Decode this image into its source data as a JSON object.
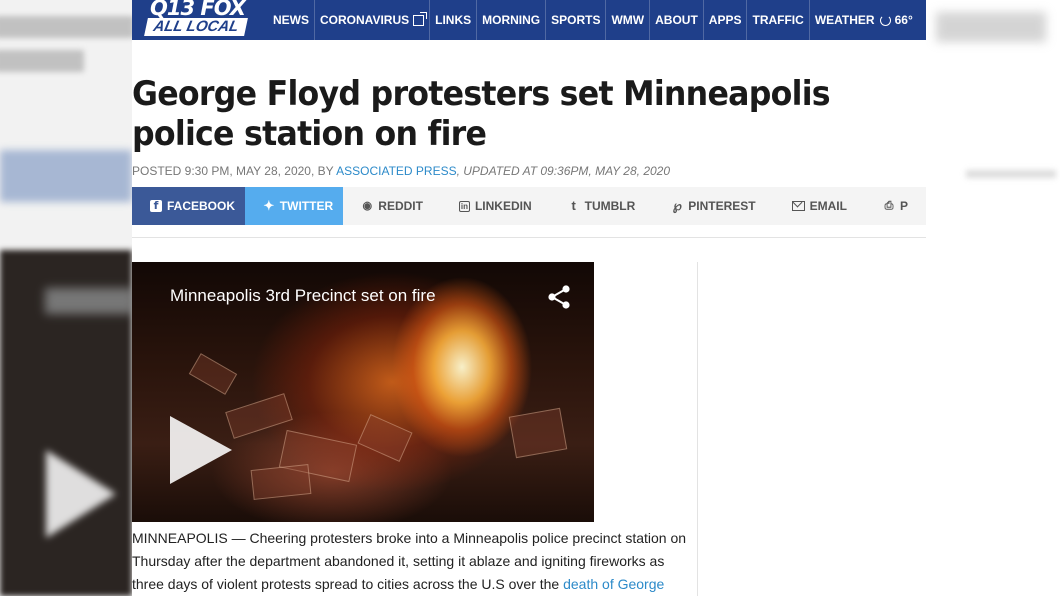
{
  "site": {
    "logo_top": "Q13 FOX",
    "logo_bottom": "ALL LOCAL"
  },
  "nav": {
    "items": [
      "NEWS",
      "CORONAVIRUS",
      "LINKS",
      "MORNING",
      "SPORTS",
      "WMW",
      "ABOUT",
      "APPS",
      "TRAFFIC",
      "WEATHER"
    ],
    "weather_temp": "66°"
  },
  "article": {
    "headline": "George Floyd protesters set Minneapolis police station on fire",
    "byline_prefix": "POSTED 9:30 PM, MAY 28, 2020, BY ",
    "author": "ASSOCIATED PRESS",
    "updated": ", UPDATED AT 09:36PM, MAY 28, 2020",
    "body_text": "MINNEAPOLIS — Cheering protesters broke into a Minneapolis police precinct station on Thursday after the department abandoned it, setting it ablaze and igniting fireworks as three days of violent protests spread to cities across the U.S over the ",
    "body_link": "death of George"
  },
  "share": {
    "buttons": [
      "FACEBOOK",
      "TWITTER",
      "REDDIT",
      "LINKEDIN",
      "TUMBLR",
      "PINTEREST",
      "EMAIL",
      "P"
    ]
  },
  "video": {
    "title": "Minneapolis 3rd Precinct set on fire"
  },
  "colors": {
    "header_bg": "#1f3f8a",
    "facebook": "#3b5998",
    "twitter": "#55acee",
    "link": "#2c8ac9"
  },
  "icons": {
    "facebook": "facebook-icon",
    "twitter": "twitter-icon",
    "reddit": "reddit-icon",
    "linkedin": "linkedin-icon",
    "tumblr": "tumblr-icon",
    "pinterest": "pinterest-icon",
    "email": "email-icon",
    "print": "print-icon",
    "share": "share-icon",
    "play": "play-icon"
  }
}
